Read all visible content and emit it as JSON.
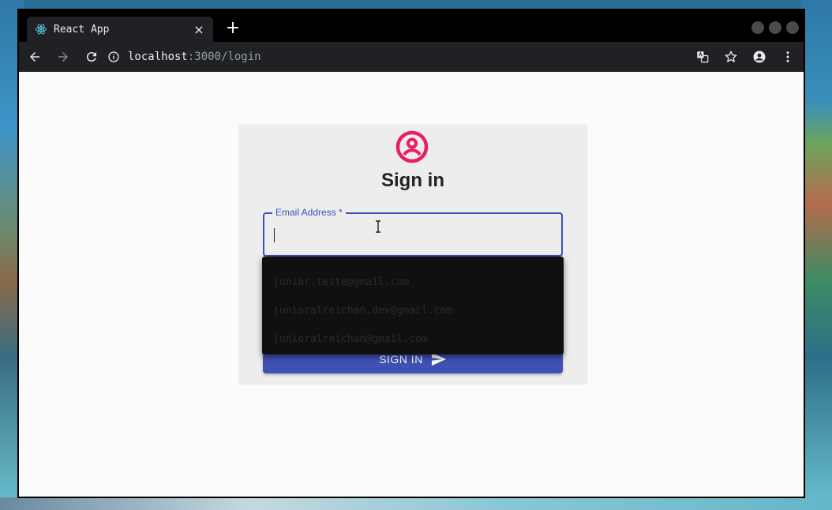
{
  "browser": {
    "tab": {
      "title": "React App",
      "close": "×"
    },
    "new_tab": "+",
    "url": {
      "host": "localhost",
      "rest": ":3000/login"
    }
  },
  "page": {
    "title": "Sign in",
    "email": {
      "label": "Email Address *",
      "value": ""
    },
    "signin_button": {
      "label": "SIGN IN"
    },
    "autocomplete": [
      "junior.teste@gmail.com",
      "junioralreichan.dev@gmail.com",
      "junioralreichan@gmail.com"
    ]
  },
  "colors": {
    "accent": "#3f51b5",
    "avatar": "#e91e63",
    "tab_bg": "#202124",
    "page_bg": "#fbfbfb"
  },
  "icons": {
    "tab": "react-logo-icon",
    "back": "arrow-back-icon",
    "forward": "arrow-forward-icon",
    "reload": "reload-icon",
    "site_info": "info-icon",
    "translate": "translate-icon",
    "bookmark": "star-icon",
    "profile": "account-circle-icon",
    "menu": "more-vert-icon",
    "avatar": "account-circle-icon",
    "send": "send-icon"
  }
}
